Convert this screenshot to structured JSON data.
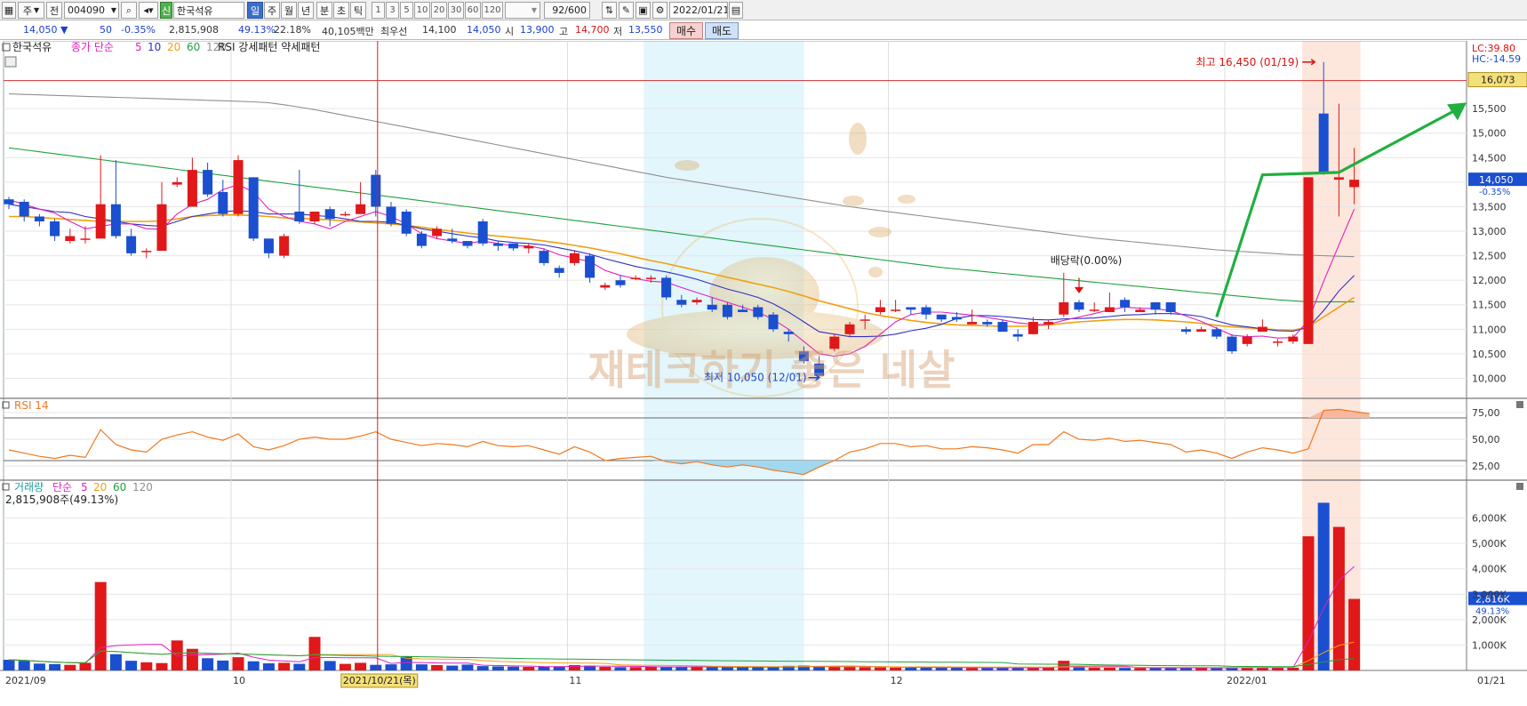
{
  "toolbar": {
    "period_select": "주",
    "prefix_label": "전",
    "stock_code": "004090",
    "credit_badge": "신",
    "stock_name": "한국석유",
    "timeframes": [
      "일",
      "주",
      "월",
      "년",
      "분",
      "초",
      "틱"
    ],
    "active_timeframe": "일",
    "minute_options": [
      "1",
      "3",
      "5",
      "10",
      "20",
      "30",
      "60",
      "120"
    ],
    "count_display": "92/600",
    "date_value": "2022/01/21"
  },
  "quote": {
    "price": "14,050",
    "change": "50",
    "change_pct": "-0.35%",
    "volume": "2,815,908",
    "volume_ratio": "49.13%",
    "turnover": "22.18%",
    "amount": "40,105백만",
    "best_bid_label": "최우선",
    "best_ask": "14,100",
    "best_bid": "14,050",
    "open_label": "시",
    "open": "13,900",
    "high_label": "고",
    "high": "14,700",
    "low_label": "저",
    "low": "13,550",
    "buy_label": "매수",
    "sell_label": "매도"
  },
  "price_panel": {
    "name_label": "한국석유",
    "ma_title": "종가 단순",
    "ma_periods": [
      "5",
      "10",
      "20",
      "60",
      "120"
    ],
    "pattern_title": "RSI 강세패턴  약세패턴",
    "right_lc": "LC:39.80",
    "right_hc": "HC:-14.59",
    "high_marker": "16,073",
    "last_price_label": "14,050",
    "last_change_label": "-0.35%",
    "max_annotation": "최고 16,450 (01/19)",
    "min_annotation": "최저 10,050 (12/01)",
    "dividend_annotation": "배당락(0.00%)",
    "watermark": "재테크하기 좋은 네살"
  },
  "rsi_panel": {
    "title": "RSI 14"
  },
  "volume_panel": {
    "title": "거래량",
    "ma_title": "단순",
    "ma_periods": [
      "5",
      "20",
      "60",
      "120"
    ],
    "total_label": "2,815,908주(49.13%)",
    "last_label": "2,816K",
    "last_pct": "49.13%"
  },
  "cursor_date": "2021/10/21(목)",
  "colors": {
    "up": "#e0181a",
    "down": "#1a4fd0",
    "ma5": "#e020c0",
    "ma10": "#3030c0",
    "ma20": "#f0a010",
    "ma60": "#20a040",
    "ma120": "#909090",
    "rsi": "#f07820",
    "arrow": "#20b040",
    "highlight_cyan": "#e2f6fc",
    "highlight_red": "#fde6dc"
  },
  "chart_data": {
    "type": "candlestick",
    "x_labels": [
      "2021/09",
      "10",
      "11",
      "12",
      "2022/01",
      "01/21"
    ],
    "price_ticks": [
      "10,000",
      "10,500",
      "11,000",
      "11,500",
      "12,000",
      "12,500",
      "13,000",
      "13,500",
      "14,000",
      "14,500",
      "15,000",
      "15,500"
    ],
    "rsi_ticks": [
      "25,00",
      "50,00",
      "75,00"
    ],
    "volume_ticks": [
      "1,000K",
      "2,000K",
      "3,000K",
      "4,000K",
      "5,000K",
      "6,000K"
    ],
    "ylim_price": [
      9700,
      16700
    ],
    "ylim_rsi": [
      15,
      80
    ],
    "ylim_volume": [
      0,
      7000
    ],
    "rsi_levels": [
      30,
      70
    ],
    "candles": [
      [
        13650,
        13550,
        13700,
        13450
      ],
      [
        13600,
        13300,
        13650,
        13200
      ],
      [
        13300,
        13200,
        13350,
        13100
      ],
      [
        13200,
        12900,
        13250,
        12800
      ],
      [
        12800,
        12900,
        13050,
        12750
      ],
      [
        12850,
        12850,
        13100,
        12750
      ],
      [
        12850,
        13550,
        14550,
        12850
      ],
      [
        13550,
        12900,
        14450,
        12850
      ],
      [
        12900,
        12550,
        13050,
        12500
      ],
      [
        12600,
        12600,
        12650,
        12450
      ],
      [
        12600,
        13550,
        14000,
        12600
      ],
      [
        13950,
        14000,
        14100,
        13900
      ],
      [
        13500,
        14250,
        14500,
        13550
      ],
      [
        14250,
        13750,
        14400,
        13700
      ],
      [
        13800,
        13350,
        14050,
        13300
      ],
      [
        13350,
        14450,
        14550,
        13300
      ],
      [
        14100,
        12850,
        14100,
        12800
      ],
      [
        12850,
        12550,
        12650,
        12450
      ],
      [
        12500,
        12900,
        12950,
        12450
      ],
      [
        13400,
        13200,
        14250,
        13150
      ],
      [
        13200,
        13400,
        13400,
        13150
      ],
      [
        13450,
        13250,
        13500,
        13100
      ],
      [
        13350,
        13350,
        13400,
        13300
      ],
      [
        13350,
        13550,
        14000,
        13450
      ],
      [
        14150,
        13500,
        14250,
        13300
      ],
      [
        13500,
        13150,
        13600,
        13100
      ],
      [
        13400,
        12950,
        13450,
        12900
      ],
      [
        12950,
        12700,
        13000,
        12650
      ],
      [
        12900,
        13050,
        13100,
        12850
      ],
      [
        12850,
        12800,
        13050,
        12750
      ],
      [
        12800,
        12700,
        12800,
        12650
      ],
      [
        13200,
        12750,
        13250,
        12700
      ],
      [
        12750,
        12700,
        12800,
        12600
      ],
      [
        12750,
        12650,
        12700,
        12600
      ],
      [
        12650,
        12700,
        12750,
        12550
      ],
      [
        12600,
        12350,
        12650,
        12300
      ],
      [
        12250,
        12150,
        12300,
        12050
      ],
      [
        12350,
        12550,
        12600,
        12300
      ],
      [
        12500,
        12050,
        12550,
        11950
      ],
      [
        11850,
        11900,
        11950,
        11800
      ],
      [
        12000,
        11900,
        12100,
        11850
      ],
      [
        12050,
        12050,
        12100,
        12000
      ],
      [
        12050,
        12050,
        12100,
        11950
      ],
      [
        12050,
        11650,
        12100,
        11600
      ],
      [
        11600,
        11500,
        11700,
        11450
      ],
      [
        11550,
        11600,
        11650,
        11500
      ],
      [
        11500,
        11400,
        11650,
        11350
      ],
      [
        11500,
        11250,
        11550,
        11200
      ],
      [
        11400,
        11350,
        11500,
        11350
      ],
      [
        11450,
        11250,
        11500,
        11200
      ],
      [
        11300,
        11000,
        11350,
        10950
      ],
      [
        10950,
        10900,
        11000,
        10750
      ],
      [
        10550,
        10350,
        10650,
        10300
      ],
      [
        10300,
        10050,
        10450,
        10000
      ],
      [
        10600,
        10850,
        10900,
        10550
      ],
      [
        10900,
        11100,
        11150,
        10850
      ],
      [
        11200,
        11200,
        11300,
        11000
      ],
      [
        11350,
        11450,
        11600,
        11300
      ],
      [
        11400,
        11400,
        11600,
        11350
      ],
      [
        11450,
        11400,
        11450,
        11300
      ],
      [
        11450,
        11300,
        11500,
        11200
      ],
      [
        11300,
        11200,
        11300,
        11150
      ],
      [
        11250,
        11200,
        11350,
        11150
      ],
      [
        11100,
        11150,
        11400,
        11100
      ],
      [
        11150,
        11100,
        11200,
        11050
      ],
      [
        11150,
        10950,
        11200,
        10950
      ],
      [
        10900,
        10850,
        11000,
        10750
      ],
      [
        10900,
        11150,
        11250,
        10900
      ],
      [
        11100,
        11150,
        11200,
        11000
      ],
      [
        11300,
        11550,
        12150,
        11250
      ],
      [
        11550,
        11400,
        11600,
        11350
      ],
      [
        11400,
        11400,
        11550,
        11350
      ],
      [
        11350,
        11450,
        11750,
        11350
      ],
      [
        11600,
        11450,
        11650,
        11350
      ],
      [
        11350,
        11400,
        11450,
        11350
      ],
      [
        11550,
        11400,
        11550,
        11300
      ],
      [
        11550,
        11350,
        11500,
        11300
      ],
      [
        11000,
        10950,
        11050,
        10900
      ],
      [
        10950,
        11000,
        11050,
        10950
      ],
      [
        11000,
        10850,
        11050,
        10800
      ],
      [
        10850,
        10550,
        10900,
        10500
      ],
      [
        10700,
        10850,
        10900,
        10650
      ],
      [
        10950,
        11050,
        11200,
        10950
      ],
      [
        10750,
        10750,
        10800,
        10650
      ],
      [
        10750,
        10850,
        10900,
        10700
      ],
      [
        10700,
        14100,
        14100,
        10700
      ],
      [
        15400,
        14200,
        16450,
        14150
      ],
      [
        14050,
        14100,
        15600,
        13300
      ],
      [
        13900,
        14050,
        14700,
        13550
      ]
    ],
    "rsi": [
      40,
      37,
      34,
      32,
      35,
      33,
      59,
      45,
      40,
      38,
      50,
      54,
      57,
      52,
      49,
      55,
      43,
      40,
      44,
      50,
      52,
      50,
      50,
      53,
      57,
      50,
      47,
      44,
      46,
      45,
      43,
      48,
      44,
      43,
      44,
      40,
      36,
      43,
      38,
      30,
      32,
      33,
      34,
      29,
      27,
      29,
      26,
      24,
      26,
      24,
      21,
      19,
      17,
      24,
      30,
      38,
      41,
      46,
      46,
      43,
      44,
      41,
      41,
      43,
      42,
      40,
      37,
      45,
      45,
      57,
      50,
      49,
      51,
      48,
      49,
      47,
      45,
      38,
      40,
      37,
      32,
      38,
      42,
      40,
      37,
      41,
      77,
      78,
      76,
      74
    ],
    "volume": [
      420,
      380,
      270,
      250,
      220,
      300,
      3480,
      640,
      380,
      320,
      290,
      1180,
      850,
      480,
      390,
      520,
      360,
      280,
      300,
      260,
      1320,
      370,
      260,
      300,
      220,
      240,
      560,
      240,
      210,
      190,
      230,
      170,
      160,
      150,
      140,
      150,
      160,
      210,
      190,
      140,
      130,
      130,
      140,
      150,
      150,
      140,
      130,
      120,
      130,
      130,
      140,
      180,
      190,
      160,
      170,
      150,
      130,
      120,
      110,
      110,
      120,
      110,
      110,
      100,
      100,
      100,
      110,
      110,
      120,
      380,
      130,
      110,
      110,
      100,
      100,
      100,
      100,
      100,
      100,
      100,
      110,
      120,
      110,
      110,
      110,
      5280,
      6600,
      5650,
      2816
    ],
    "ma5": [
      13640,
      13550,
      13450,
      13370,
      13200,
      13050,
      13100,
      13150,
      13150,
      13050,
      13040,
      13350,
      13550,
      13650,
      13850,
      13950,
      13800,
      13450,
      13300,
      13200,
      13150,
      13050,
      13200,
      13300,
      13400,
      13300,
      13150,
      12950,
      12850,
      12800,
      12750,
      12800,
      12750,
      12700,
      12700,
      12640,
      12520,
      12450,
      12380,
      12200,
      12100,
      12030,
      11980,
      11960,
      11850,
      11750,
      11650,
      11550,
      11450,
      11350,
      11200,
      11000,
      10750,
      10500,
      10450,
      10500,
      10650,
      10900,
      11150,
      11300,
      11350,
      11350,
      11320,
      11290,
      11240,
      11190,
      11130,
      11100,
      11100,
      11180,
      11250,
      11320,
      11400,
      11450,
      11430,
      11420,
      11380,
      11270,
      11160,
      11020,
      10880,
      10850,
      10860,
      10820,
      10830,
      11180,
      11980,
      12720,
      13450
    ],
    "ma10": [
      13550,
      13500,
      13450,
      13400,
      13380,
      13300,
      13250,
      13200,
      13150,
      13120,
      13100,
      13200,
      13300,
      13350,
      13400,
      13420,
      13400,
      13350,
      13350,
      13350,
      13320,
      13300,
      13250,
      13200,
      13200,
      13180,
      13120,
      13050,
      13000,
      12950,
      12900,
      12860,
      12800,
      12770,
      12750,
      12720,
      12660,
      12600,
      12530,
      12440,
      12360,
      12280,
      12220,
      12170,
      12100,
      12020,
      11920,
      11820,
      11740,
      11650,
      11520,
      11350,
      11150,
      10950,
      10900,
      10850,
      10850,
      10860,
      10900,
      10970,
      11020,
      11100,
      11220,
      11280,
      11280,
      11260,
      11230,
      11200,
      11190,
      11210,
      11220,
      11230,
      11260,
      11290,
      11300,
      11320,
      11320,
      11300,
      11260,
      11170,
      11090,
      11050,
      11010,
      10970,
      10960,
      11040,
      11380,
      11780,
      12100
    ],
    "ma20": [
      13300,
      13300,
      13280,
      13260,
      13240,
      13220,
      13200,
      13200,
      13200,
      13200,
      13210,
      13250,
      13300,
      13320,
      13330,
      13330,
      13320,
      13300,
      13270,
      13260,
      13250,
      13230,
      13210,
      13190,
      13170,
      13150,
      13120,
      13080,
      13040,
      13000,
      12960,
      12930,
      12900,
      12870,
      12840,
      12800,
      12760,
      12710,
      12660,
      12600,
      12540,
      12470,
      12400,
      12340,
      12270,
      12200,
      12130,
      12060,
      11990,
      11920,
      11850,
      11770,
      11680,
      11580,
      11500,
      11420,
      11340,
      11280,
      11230,
      11180,
      11140,
      11110,
      11090,
      11080,
      11070,
      11060,
      11060,
      11070,
      11090,
      11120,
      11150,
      11170,
      11190,
      11200,
      11200,
      11190,
      11170,
      11150,
      11120,
      11080,
      11050,
      11030,
      11010,
      10990,
      10980,
      11050,
      11250,
      11450,
      11650
    ],
    "ma60": [
      14700,
      14660,
      14620,
      14580,
      14540,
      14500,
      14460,
      14420,
      14380,
      14340,
      14300,
      14260,
      14220,
      14180,
      14140,
      14100,
      14060,
      14020,
      13980,
      13940,
      13900,
      13860,
      13820,
      13780,
      13740,
      13700,
      13660,
      13620,
      13580,
      13540,
      13500,
      13460,
      13420,
      13380,
      13340,
      13300,
      13260,
      13220,
      13180,
      13140,
      13100,
      13060,
      13020,
      12980,
      12940,
      12900,
      12860,
      12820,
      12780,
      12740,
      12700,
      12660,
      12620,
      12580,
      12540,
      12500,
      12460,
      12420,
      12380,
      12340,
      12300,
      12260,
      12230,
      12200,
      12170,
      12140,
      12110,
      12080,
      12050,
      12020,
      11990,
      11960,
      11930,
      11900,
      11870,
      11840,
      11810,
      11780,
      11750,
      11720,
      11690,
      11660,
      11630,
      11600,
      11580,
      11560,
      11560,
      11560,
      11560
    ],
    "ma120": [
      15800,
      15790,
      15780,
      15770,
      15760,
      15750,
      15740,
      15730,
      15720,
      15710,
      15700,
      15690,
      15680,
      15670,
      15660,
      15650,
      15640,
      15620,
      15580,
      15530,
      15480,
      15420,
      15360,
      15300,
      15240,
      15180,
      15120,
      15060,
      15000,
      14940,
      14880,
      14820,
      14760,
      14700,
      14640,
      14580,
      14520,
      14460,
      14400,
      14340,
      14280,
      14220,
      14160,
      14100,
      14050,
      14000,
      13950,
      13900,
      13850,
      13800,
      13750,
      13700,
      13650,
      13600,
      13550,
      13500,
      13460,
      13420,
      13380,
      13340,
      13300,
      13260,
      13220,
      13180,
      13140,
      13100,
      13060,
      13020,
      12980,
      12940,
      12900,
      12860,
      12830,
      12800,
      12770,
      12740,
      12710,
      12680,
      12650,
      12620,
      12600,
      12580,
      12560,
      12540,
      12520,
      12510,
      12500,
      12490,
      12480
    ]
  }
}
